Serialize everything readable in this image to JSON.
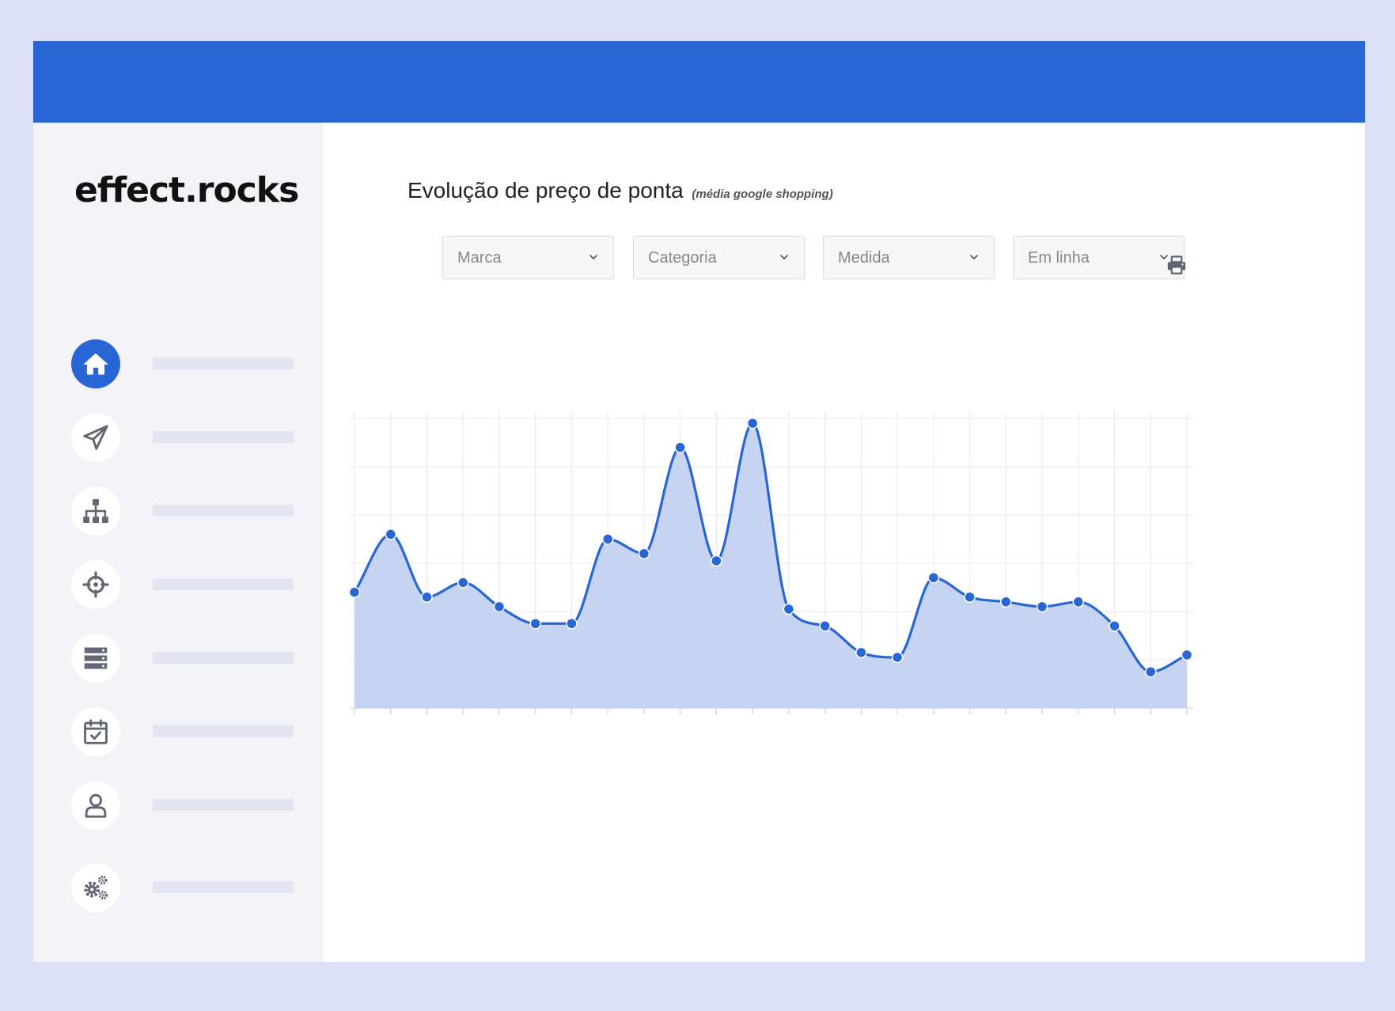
{
  "app": {
    "brand": "effect.rocks",
    "accent_color": "#2866d6",
    "background_color": "#dddff5"
  },
  "sidebar": {
    "items": [
      {
        "icon": "home-icon",
        "active": true
      },
      {
        "icon": "paper-plane-icon",
        "active": false
      },
      {
        "icon": "sitemap-icon",
        "active": false
      },
      {
        "icon": "crosshairs-icon",
        "active": false
      },
      {
        "icon": "server-icon",
        "active": false
      },
      {
        "icon": "calendar-check-icon",
        "active": false
      },
      {
        "icon": "user-icon",
        "active": false
      },
      {
        "icon": "gears-icon",
        "active": false
      }
    ]
  },
  "main": {
    "title": "Evolução de preço de ponta",
    "subtitle": "(média google shopping)",
    "filters": [
      {
        "name": "marca-select",
        "selected": "Marca"
      },
      {
        "name": "categoria-select",
        "selected": "Categoria"
      },
      {
        "name": "medida-select",
        "selected": "Medida"
      },
      {
        "name": "em-linha-select",
        "selected": "Em linha"
      }
    ],
    "print_icon": "print-icon"
  },
  "chart_data": {
    "type": "area",
    "title": "Evolução de preço de ponta",
    "subtitle": "(média google shopping)",
    "xlabel": "",
    "ylabel": "",
    "x": [
      1,
      2,
      3,
      4,
      5,
      6,
      7,
      8,
      9,
      10,
      11,
      12,
      13,
      14,
      15,
      16,
      17,
      18,
      19,
      20,
      21,
      22,
      23,
      24
    ],
    "series": [
      {
        "values": [
          2.4,
          3.6,
          2.3,
          2.6,
          2.1,
          1.75,
          1.75,
          3.5,
          3.2,
          5.4,
          3.05,
          5.9,
          2.05,
          1.7,
          1.15,
          1.05,
          2.7,
          2.3,
          2.2,
          2.1,
          2.2,
          1.7,
          0.75,
          1.1
        ],
        "color": "#2866d6",
        "fill": "#c3d2f1"
      }
    ],
    "ylim": [
      0,
      6
    ],
    "grid": true,
    "legend": "none",
    "x_ticks_labeled": false,
    "y_ticks_labeled": false
  }
}
